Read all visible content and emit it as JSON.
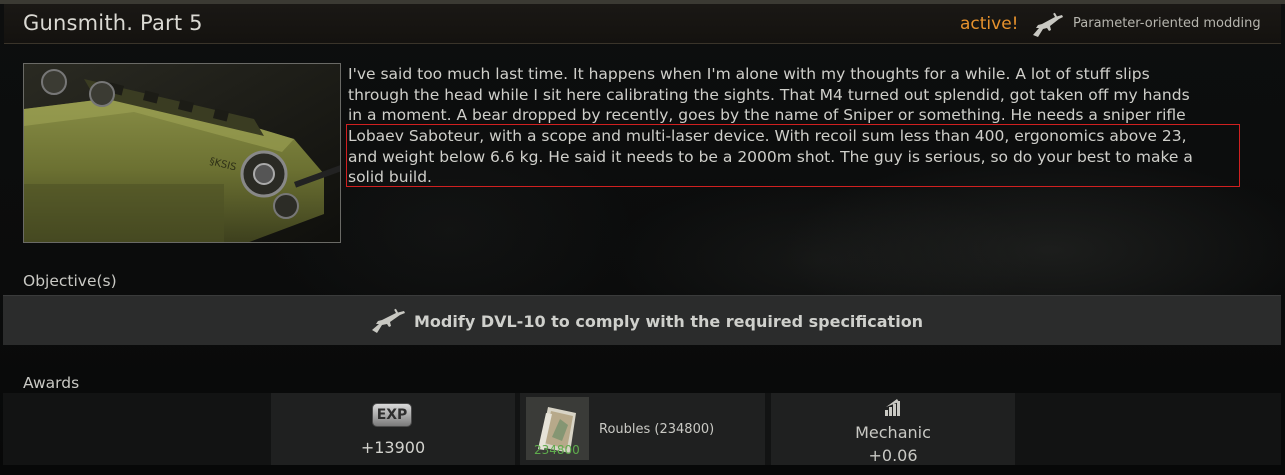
{
  "quest": {
    "title": "Gunsmith. Part 5",
    "status": "active!",
    "type_label": "Parameter-oriented modding"
  },
  "icons": {
    "header_weapon": "rifle-icon",
    "objective_weapon": "rifle-icon",
    "exp": "exp-badge-icon",
    "roubles": "roubles-stack-icon",
    "skill": "mechanic-skill-icon"
  },
  "description": {
    "lines": [
      "I've said too much last time. It happens when I'm alone with my thoughts for a while. A lot of stuff slips",
      "through the head while I sit here calibrating the sights. That M4 turned out splendid, got taken off my hands",
      "in a moment. A bear dropped by recently, goes by the name of Sniper or something. He needs a sniper rifle",
      "Lobaev Saboteur, with a scope and multi-laser device. With recoil sum less than 400, ergonomics above 23,",
      "and weight below 6.6 kg. He said it needs to be a 2000m shot. The guy is serious, so do your best to make a",
      "solid build."
    ],
    "highlight_color": "#d02020"
  },
  "objectives": {
    "label": "Objective(s)",
    "items": [
      {
        "text": "Modify DVL-10 to comply with the required specification"
      }
    ]
  },
  "awards": {
    "label": "Awards",
    "exp": {
      "badge": "EXP",
      "value": "+13900"
    },
    "money": {
      "count": "234800",
      "name": "Roubles (234800)"
    },
    "skill": {
      "name": "Mechanic",
      "value": "+0.06"
    }
  },
  "colors": {
    "status_active": "#e7922d",
    "money_count": "#5eab4c",
    "weapon_olive": "#6f7433"
  }
}
